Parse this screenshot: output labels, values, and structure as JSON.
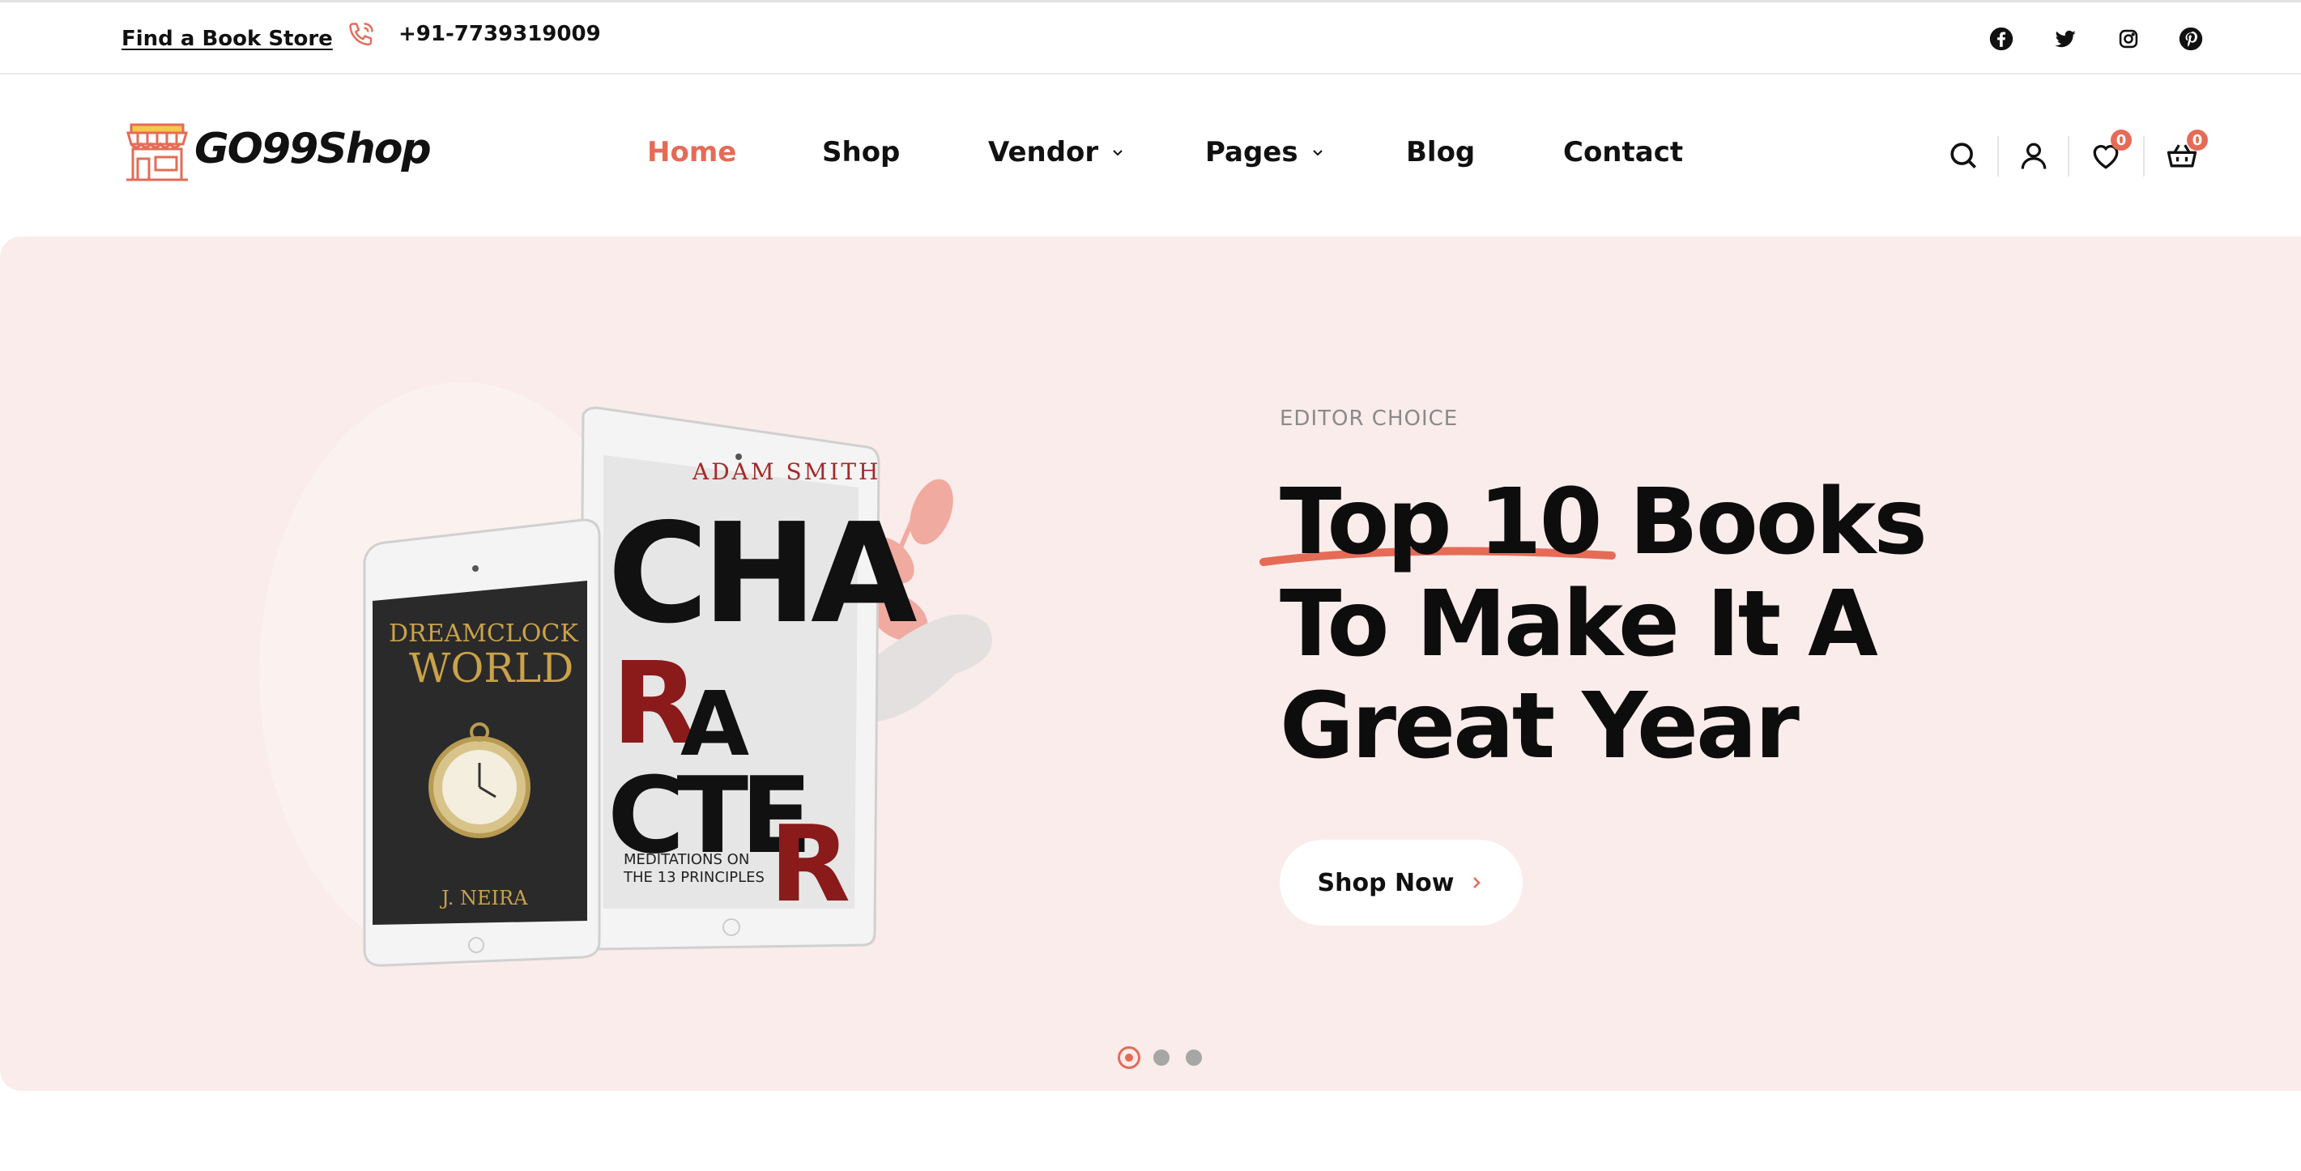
{
  "topbar": {
    "store_link": "Find a Book Store",
    "phone": "+91-7739319009",
    "phone_icon": "phone-icon",
    "social_icons": [
      "facebook-icon",
      "twitter-icon",
      "instagram-icon",
      "pinterest-icon"
    ]
  },
  "header": {
    "logo_text": "GO99Shop",
    "nav": [
      {
        "label": "Home",
        "active": true
      },
      {
        "label": "Shop"
      },
      {
        "label": "Vendor",
        "dropdown": true
      },
      {
        "label": "Pages",
        "dropdown": true
      },
      {
        "label": "Blog"
      },
      {
        "label": "Contact"
      }
    ],
    "wishlist_count": "0",
    "cart_count": "0"
  },
  "hero": {
    "eyebrow": "EDITOR CHOICE",
    "headline": [
      "Top 10 Books",
      "To Make It A",
      "Great Year"
    ],
    "button_label": "Shop Now",
    "book_left": {
      "title_top": "DREAMCLOCK",
      "title_bottom": "WORLD",
      "author": "J. NEIRA"
    },
    "book_right": {
      "author": "ADAM SMITH",
      "title": "CHARACTER",
      "subtitle_1": "MEDITATIONS ON",
      "subtitle_2": "THE 13 PRINCIPLES"
    },
    "slides": 3,
    "active_slide": 1
  },
  "colors": {
    "accent": "#e56b57",
    "hero_bg": "#f9ecea",
    "text": "#111111"
  }
}
